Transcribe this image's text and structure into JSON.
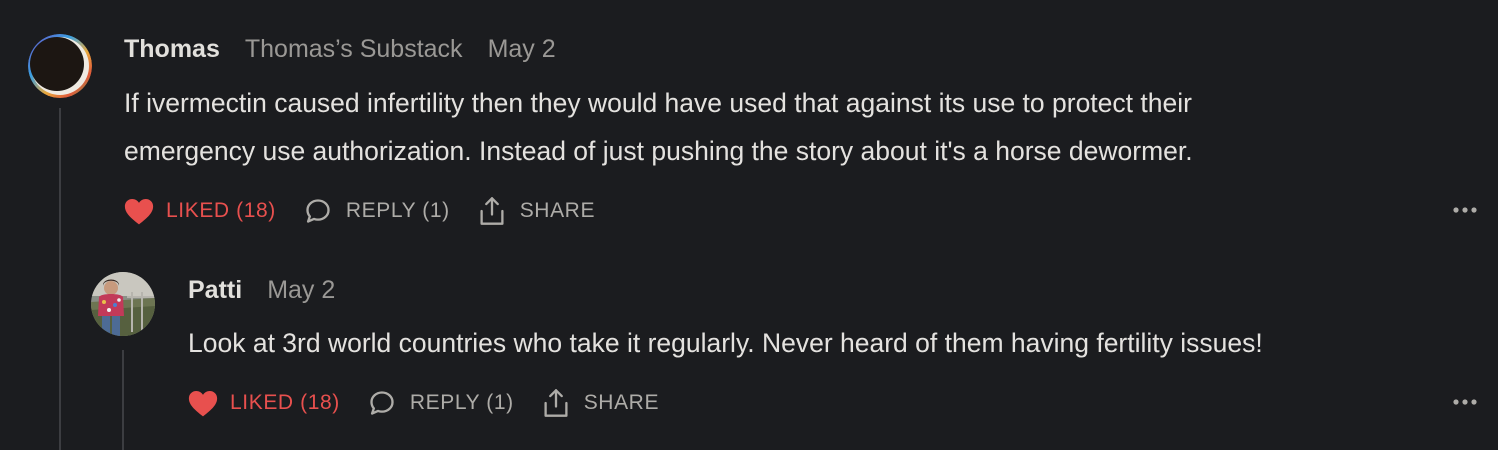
{
  "comments": [
    {
      "author": "Thomas",
      "publication": "Thomas’s Substack",
      "date": "May 2",
      "lines": [
        "If ivermectin caused infertility then they would have used that against its use to protect their",
        "emergency use authorization. Instead of just pushing the story about it's a horse dewormer."
      ],
      "like_label": "LIKED (18)",
      "reply_label": "REPLY (1)",
      "share_label": "SHARE"
    },
    {
      "author": "Patti",
      "date": "May 2",
      "lines": [
        "Look at 3rd world countries who take it regularly. Never heard of them having fertility issues!"
      ],
      "like_label": "LIKED (18)",
      "reply_label": "REPLY (1)",
      "share_label": "SHARE"
    }
  ],
  "icons": {
    "like": "heart-icon",
    "reply": "speech-bubble-icon",
    "share": "share-upload-icon",
    "more": "more-dots-icon"
  },
  "colors": {
    "background": "#1b1c1f",
    "liked": "#e8504e",
    "muted": "#9a9895",
    "text": "#e4e2df"
  }
}
